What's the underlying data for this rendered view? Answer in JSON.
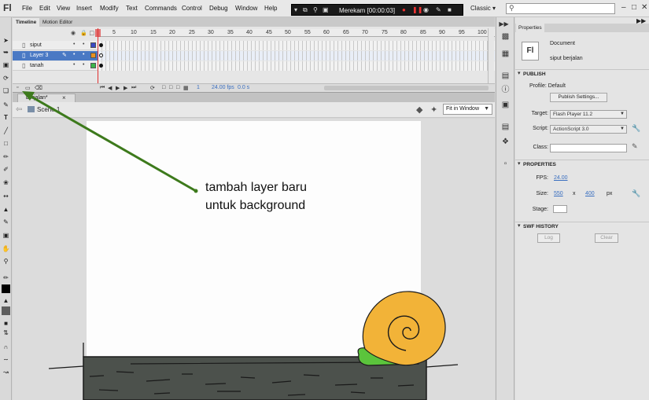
{
  "app": {
    "logo": "Fl"
  },
  "menubar": {
    "items": [
      "File",
      "Edit",
      "View",
      "Insert",
      "Modify",
      "Text",
      "Commands",
      "Control",
      "Debug",
      "Window",
      "Help"
    ],
    "recorder_label": "Merekam [00:00:03]",
    "workspace": "Classic",
    "workspace_caret": "▾",
    "search_icon": "magnifier-icon",
    "window_controls": [
      "–",
      "□",
      "✕"
    ]
  },
  "timeline": {
    "tabs": [
      "Timeline",
      "Motion Editor"
    ],
    "ruler": [
      "5",
      "10",
      "15",
      "20",
      "25",
      "30",
      "35",
      "40",
      "45",
      "50",
      "55",
      "60",
      "65",
      "70",
      "75",
      "80",
      "85",
      "90",
      "95",
      "100"
    ],
    "layers": [
      {
        "name": "siput",
        "color": "#3a49c4",
        "selected": false
      },
      {
        "name": "Layer 3",
        "color": "#e89020",
        "selected": true
      },
      {
        "name": "tanah",
        "color": "#3cb54a",
        "selected": false
      }
    ],
    "frame_rate": "24.00 fps",
    "current_frame": "1",
    "elapsed": "0.0 s"
  },
  "document": {
    "tab_label": "berjalan*",
    "tab_close": "×",
    "scene_label": "Scene 1",
    "zoom": "Fit in Window"
  },
  "annotation": {
    "text": "tambah layer baru\nuntuk background",
    "arrow_color": "#3d7a1c"
  },
  "properties": {
    "tab": "Properties",
    "doc_type": "Document",
    "doc_name": "siput berjalan",
    "sections": {
      "publish": "PUBLISH",
      "properties": "PROPERTIES",
      "swf_history": "SWF HISTORY"
    },
    "profile": "Profile: Default",
    "publish_settings_button": "Publish Settings...",
    "target_label": "Target:",
    "target_value": "Flash Player 11.2",
    "script_label": "Script:",
    "script_value": "ActionScript 3.0",
    "class_label": "Class:",
    "fps_label": "FPS:",
    "fps_value": "24.00",
    "size_label": "Size:",
    "width": "550",
    "size_x": "x",
    "height": "400",
    "size_unit": "px",
    "stage_label": "Stage:",
    "stage_color": "#ffffff",
    "log_button": "Log",
    "clear_button": "Clear"
  },
  "colors": {
    "snail_shell": "#f2b338",
    "snail_body": "#5bc43c",
    "ground": "#4c514c",
    "selected_layer": "#4a79c4"
  }
}
